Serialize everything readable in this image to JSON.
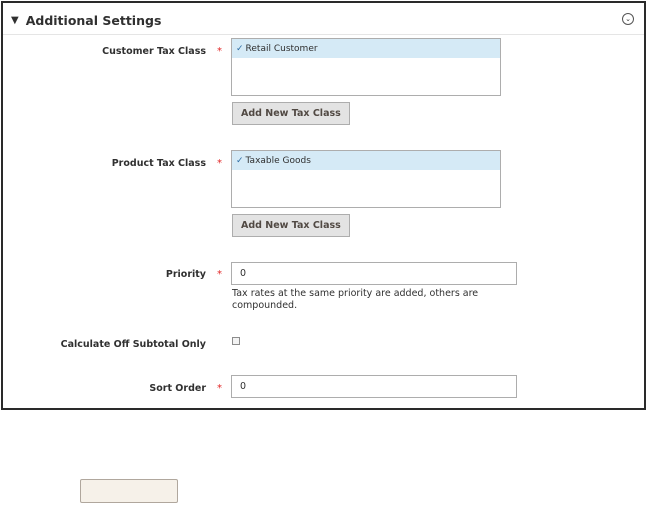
{
  "section": {
    "title": "Additional Settings",
    "caret": "▼",
    "collapse_icon": "chevron-down-circle-icon"
  },
  "fields": {
    "customer_tax_class": {
      "label": "Customer Tax Class",
      "required_mark": "*",
      "selected_option": "Retail Customer",
      "button_label": "Add New Tax Class"
    },
    "product_tax_class": {
      "label": "Product Tax Class",
      "required_mark": "*",
      "selected_option": "Taxable Goods",
      "button_label": "Add New Tax Class"
    },
    "priority": {
      "label": "Priority",
      "required_mark": "*",
      "value": "0",
      "note": "Tax rates at the same priority are added, others are compounded."
    },
    "calculate_off_subtotal": {
      "label": "Calculate Off Subtotal Only",
      "checked": false
    },
    "sort_order": {
      "label": "Sort Order",
      "required_mark": "*",
      "value": "0"
    }
  },
  "colors": {
    "required": "#e22626",
    "selected_option_bg": "#d5eaf6",
    "button_bg": "#e3e3e3",
    "bottom_button_bg": "#f6f1e9"
  }
}
